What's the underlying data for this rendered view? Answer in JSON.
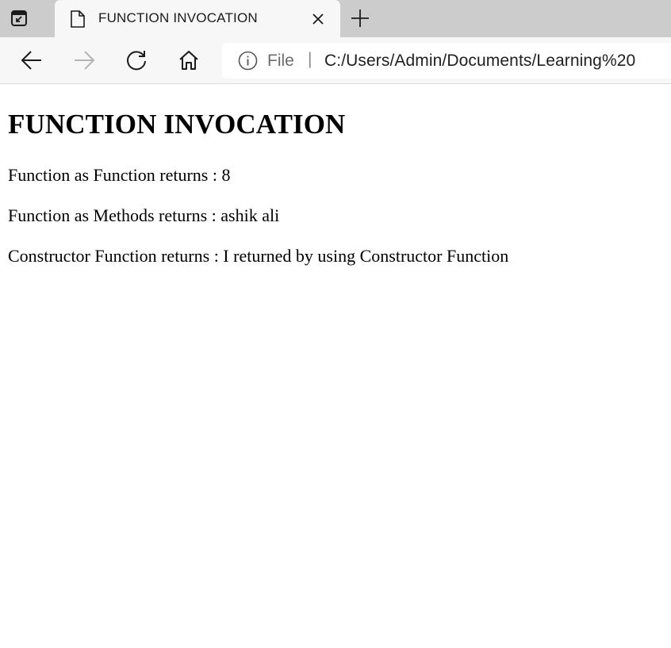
{
  "browser": {
    "tab": {
      "title": "FUNCTION INVOCATION",
      "icon": "page-icon"
    },
    "address_bar": {
      "scheme_label": "File",
      "separator": "|",
      "url": "C:/Users/Admin/Documents/Learning%20"
    },
    "icons": {
      "tab_actions": "tab-actions-icon",
      "close": "close-icon",
      "new_tab": "plus-icon",
      "back": "back-arrow-icon",
      "forward": "forward-arrow-icon",
      "refresh": "refresh-icon",
      "home": "home-icon",
      "info": "info-icon"
    },
    "colors": {
      "tabstrip_bg": "#cccccc",
      "toolbar_bg": "#f7f7f7",
      "forward_disabled": "#b5b5b5"
    }
  },
  "page": {
    "heading": "FUNCTION INVOCATION",
    "lines": [
      "Function as Function returns : 8",
      "Function as Methods returns : ashik ali",
      "Constructor Function returns : I returned by using Constructor Function"
    ]
  }
}
